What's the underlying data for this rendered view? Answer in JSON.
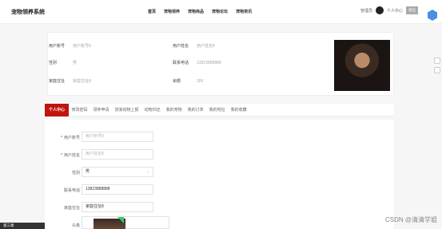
{
  "header": {
    "logo": "宠物领养系统",
    "nav": [
      "首页",
      "宠物领养",
      "宠物商品",
      "宠物论坛",
      "宠物资讯"
    ],
    "username": "管理员",
    "user_center": "个人中心",
    "logout": "退出"
  },
  "profile_card": {
    "rows": [
      {
        "key": "用户账号",
        "value": "用户账号8"
      },
      {
        "key": "用户姓名",
        "value": "用户姓名8"
      },
      {
        "key": "性别",
        "value": "男"
      },
      {
        "key": "联系电话",
        "value": "13823888888"
      },
      {
        "key": "家庭住址",
        "value": "家庭住址8"
      },
      {
        "key": "余额",
        "value": "300"
      }
    ]
  },
  "tabs": [
    "个人中心",
    "修改密码",
    "领养申请",
    "流浪动物上报",
    "动物归还",
    "我的宠物",
    "我的订单",
    "我的地址",
    "我的收藏"
  ],
  "form": {
    "fields": [
      {
        "label": "用户账号",
        "required": true,
        "value": "用户账号8",
        "placeholder": true
      },
      {
        "label": "用户姓名",
        "required": true,
        "value": "用户姓名8",
        "placeholder": true
      },
      {
        "label": "性别",
        "required": false,
        "value": "男",
        "placeholder": false,
        "select": true
      },
      {
        "label": "联系电话",
        "required": false,
        "value": "13823888888",
        "placeholder": false
      },
      {
        "label": "家庭住址",
        "required": false,
        "value": "家庭住址8",
        "placeholder": false
      }
    ],
    "avatar_label": "头像"
  },
  "footer": {
    "left_text": "第三章"
  },
  "watermark": "CSDN @清清学姐",
  "colors": {
    "accent": "#c0150f",
    "badge": "#4a90e2"
  }
}
